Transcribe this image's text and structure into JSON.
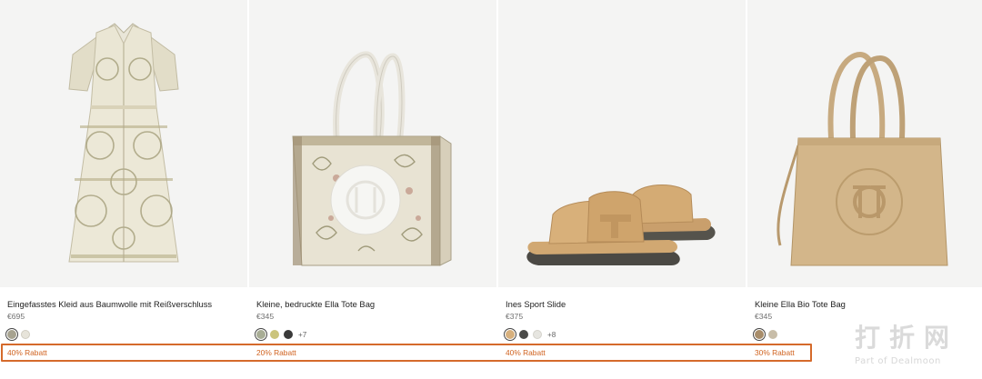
{
  "products": [
    {
      "name": "Eingefasstes Kleid aus Baumwolle mit Reißverschluss",
      "price": "€695",
      "swatch_colors": [
        "#a7a390",
        "#e7e4da"
      ],
      "more_colors": "",
      "discount": "40% Rabatt",
      "image": "printed-shirt-dress"
    },
    {
      "name": "Kleine, bedruckte Ella Tote Bag",
      "price": "€345",
      "swatch_colors": [
        "#a8ad95",
        "#cbc47c",
        "#3a3a3a"
      ],
      "more_colors": "+7",
      "discount": "20% Rabatt",
      "image": "printed-tote-bag"
    },
    {
      "name": "Ines Sport Slide",
      "price": "€375",
      "swatch_colors": [
        "#d7b07d",
        "#4a4a48",
        "#e6e5e0"
      ],
      "more_colors": "+8",
      "discount": "40% Rabatt",
      "image": "sport-slide-sandal"
    },
    {
      "name": "Kleine Ella Bio Tote Bag",
      "price": "€345",
      "swatch_colors": [
        "#a88d6a",
        "#c8bda8"
      ],
      "more_colors": "",
      "discount": "30% Rabatt",
      "image": "tan-tote-bag"
    }
  ],
  "watermark": {
    "cn": "打折网",
    "en": "Part of Dealmoon"
  },
  "colors": {
    "discount_text": "#d0621f",
    "highlight_box": "#d56a2b"
  }
}
